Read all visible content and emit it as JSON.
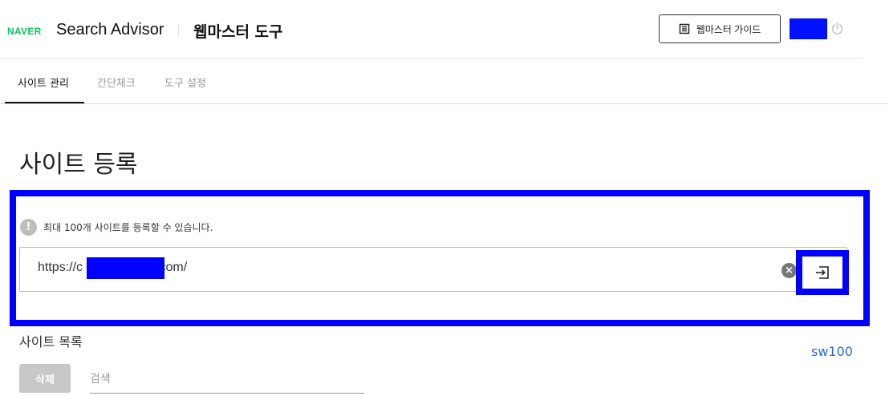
{
  "header": {
    "logo_text": "NAVER",
    "app_name": "Search Advisor",
    "tool_name": "웹마스터 도구",
    "guide_button_label": "웹마스터 가이드",
    "colors": {
      "logo": "#03c75a",
      "redaction": "#0011ff"
    }
  },
  "tabs": [
    {
      "label": "사이트 관리",
      "active": true
    },
    {
      "label": "간단체크",
      "active": false
    },
    {
      "label": "도구 설정",
      "active": false
    }
  ],
  "main": {
    "page_title": "사이트 등록",
    "notice_icon": "!",
    "notice_text": "최대 100개 사이트를 등록할 수 있습니다.",
    "url_prefix": "https://c",
    "url_suffix": ".com/",
    "clear_icon": "×",
    "list_title": "사이트 목록",
    "user_id": "sw100",
    "delete_label": "삭제",
    "search_placeholder": "검색",
    "highlight_color": "#0000ff"
  }
}
